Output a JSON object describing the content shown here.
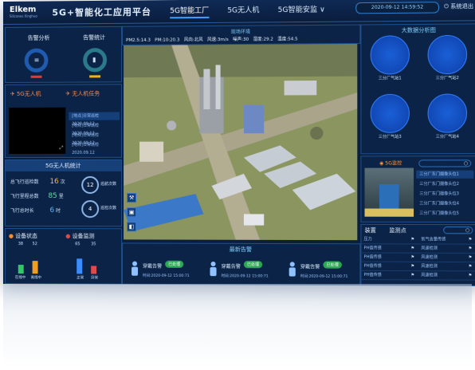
{
  "app": {
    "logo": "Elkem",
    "logo_sub": "Silicones Xinghuo",
    "title": "5G+智能化工应用平台",
    "nav": [
      "5G智能工厂",
      "5G无人机",
      "5G智能安监 ∨"
    ],
    "datetime": "2020-09-12 14:59:52",
    "logout": "系统退出"
  },
  "left": {
    "stats_headers": [
      "告警分析",
      "告警统计"
    ],
    "gauge_icons": [
      "list-icon",
      "chart-icon"
    ],
    "drone_header": "5G无人机",
    "task_header": "无人机任务",
    "tasks": [
      "[地点]日常巡检2020.09.12",
      "[地点]日常巡检2020.09.12",
      "[地点]日常巡检2020.09.12",
      "[地点]日常巡检2020.09.12"
    ],
    "stats_title": "5G无人机统计",
    "stats": [
      {
        "label": "总飞行巡检数",
        "value": "16",
        "unit": "次"
      },
      {
        "label": "飞行里程总数",
        "value": "85",
        "unit": "里"
      },
      {
        "label": "飞行总时长",
        "value": "6",
        "unit": "时"
      }
    ],
    "circle_stats": [
      {
        "value": "12",
        "label": "巡航次数"
      },
      {
        "value": "4",
        "label": "巡检次数"
      }
    ],
    "device_status": {
      "title": "设备状态",
      "values": [
        "38",
        "52"
      ],
      "labels": [
        "在线中",
        "离线中"
      ],
      "colors": [
        "#31c767",
        "#f0a020"
      ]
    },
    "device_monitor": {
      "title": "设备监测",
      "values": [
        "65",
        "35"
      ],
      "labels": [
        "正常",
        "异常"
      ],
      "colors": [
        "#3a8cff",
        "#e04a4a"
      ]
    }
  },
  "center": {
    "env_title": "现场环境",
    "env": [
      "PM2.5:14.3",
      "PM:10:20.3",
      "风向:北风",
      "风速:3m/s",
      "噪声:30",
      "湿度:29.2",
      "温度:54.5"
    ],
    "alarm_title": "最新告警",
    "alarms": [
      {
        "type": "穿戴告警",
        "status": "已处理",
        "time": "时间:2020-09-12 15:00:71"
      },
      {
        "type": "穿戴告警",
        "status": "已处理",
        "time": "时间:2020-09-12 15:00:71"
      },
      {
        "type": "穿戴告警",
        "status": "已处理",
        "time": "时间:2020-09-12 15:00:71"
      }
    ]
  },
  "right": {
    "radar_title": "大数据分析图",
    "radars": [
      "三分厂气站1",
      "三分厂气站2",
      "三分厂气站3",
      "三分厂气站4"
    ],
    "cam_title": "5G监控",
    "cam_list": [
      "三分厂东门摄像头位1",
      "三分厂东门摄像头位2",
      "三分厂东门摄像头位3",
      "三分厂东门摄像头位4",
      "三分厂东门摄像头位5"
    ],
    "tabs": [
      "装置",
      "监测点"
    ],
    "points": [
      "压力",
      "PH值传感",
      "PH值传感",
      "PH值传感",
      "PH值传感"
    ],
    "points2": [
      "氧气含量传感",
      "风速检测",
      "风速检测",
      "风速检测",
      "风速检测"
    ]
  }
}
